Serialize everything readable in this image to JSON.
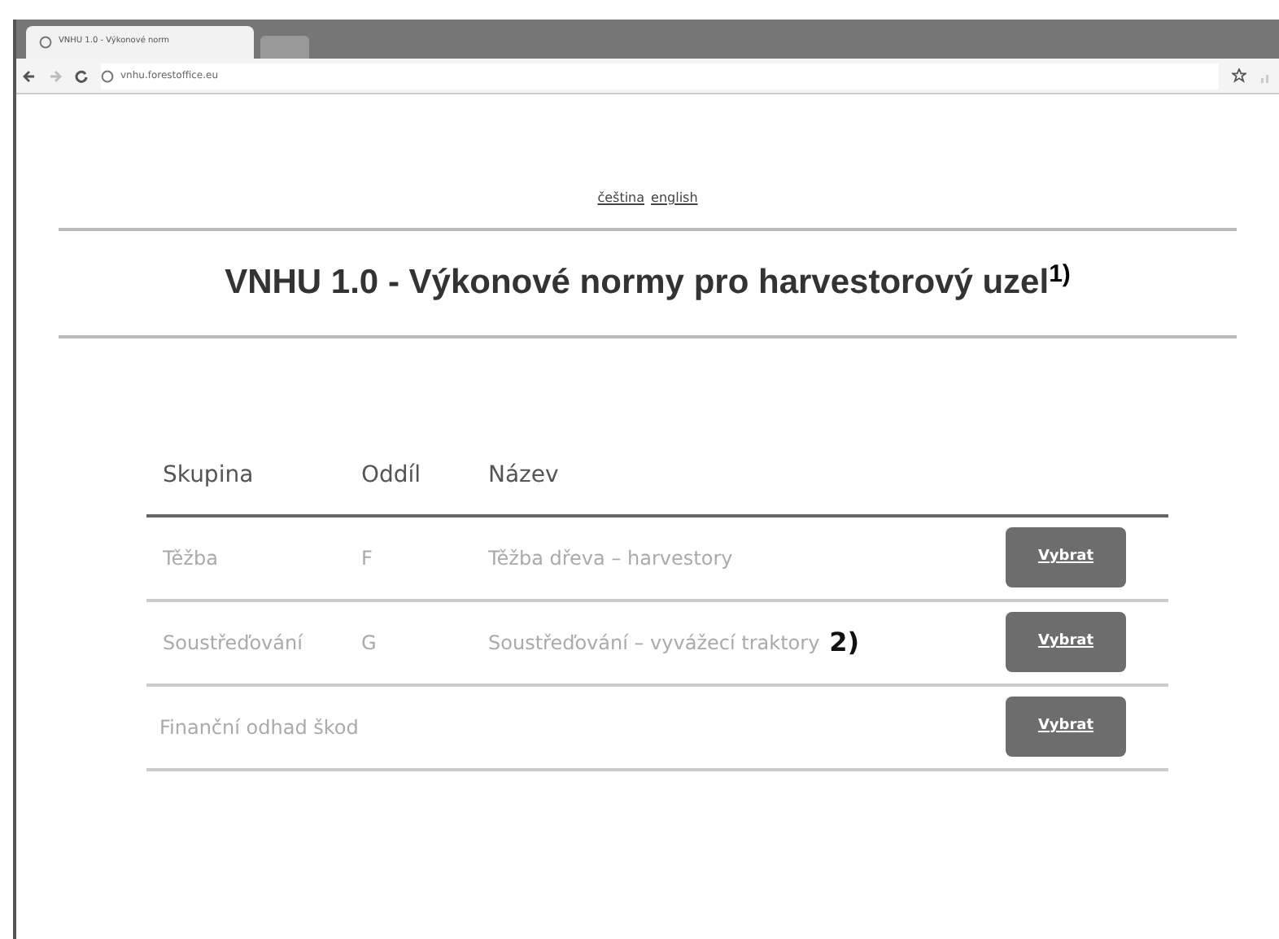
{
  "browser": {
    "tab_title": "VNHU 1.0 - Výkonové norm",
    "address": "vnhu.forestoffice.eu"
  },
  "languages": [
    {
      "label": "čeština"
    },
    {
      "label": "english"
    }
  ],
  "title": "VNHU 1.0 - Výkonové normy pro harvestorový uzel$^{1)}$",
  "table": {
    "columns": [
      "Skupina",
      "Oddíl",
      "Název"
    ],
    "rows": [
      {
        "skupina": "Těžba",
        "oddil": "F",
        "nazev": "Těžba dřeva – harvestory",
        "action": "Vybrat"
      },
      {
        "skupina": "Soustřeďování",
        "oddil": "G",
        "nazev": "Soustřeďování – vyvážecí traktory",
        "note": "2)",
        "action": "Vybrat"
      },
      {
        "skupina": "Finanční odhad škod",
        "action": "Vybrat"
      }
    ]
  }
}
